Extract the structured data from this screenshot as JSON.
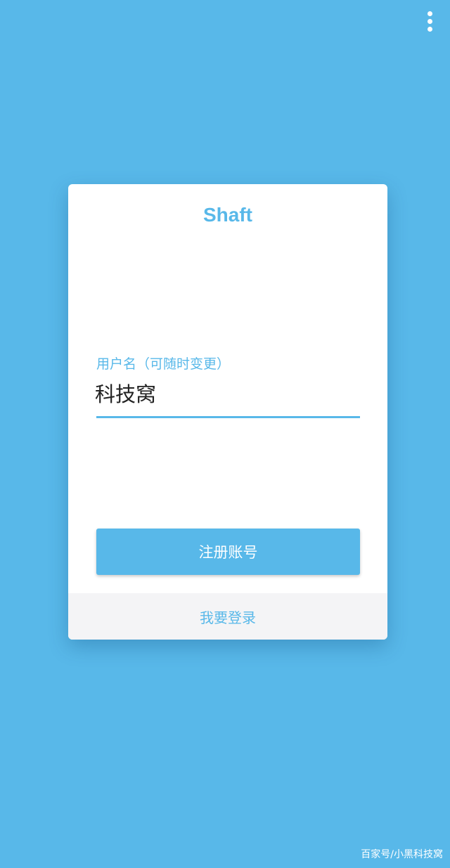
{
  "menu": {
    "icon": "more-vert-icon"
  },
  "card": {
    "app_title": "Shaft",
    "username_field": {
      "label": "用户名（可随时变更）",
      "value": "科技窝"
    },
    "register_button_label": "注册账号",
    "login_link_label": "我要登录"
  },
  "watermark": "百家号/小黑科技窝",
  "colors": {
    "background": "#58b8e9",
    "accent": "#58b8e9",
    "card": "#ffffff",
    "footer": "#f4f4f6",
    "input_text": "#222222"
  }
}
